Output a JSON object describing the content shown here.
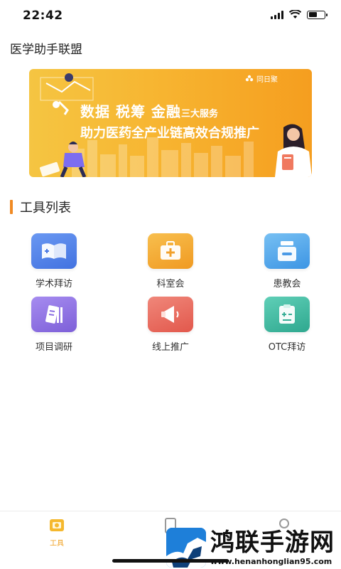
{
  "status_bar": {
    "time": "22:42",
    "icons": [
      "signal-icon",
      "wifi-icon",
      "battery-icon"
    ]
  },
  "header": {
    "title": "医学助手联盟"
  },
  "banner": {
    "brand": "同日聚",
    "line1_main": "数据 税筹 金融",
    "line1_suffix": "三大服务",
    "line2": "助力医药全产业链高效合规推广",
    "colors": {
      "start": "#f5c542",
      "end": "#f59e1f"
    }
  },
  "tools_section": {
    "title": "工具列表",
    "accent": "#f08a24",
    "items": [
      {
        "label": "学术拜访",
        "icon": "open-book-icon",
        "color": "#4f7fe8"
      },
      {
        "label": "科室会",
        "icon": "medical-kit-icon",
        "color": "#f4a52a"
      },
      {
        "label": "患教会",
        "icon": "medicine-box-icon",
        "color": "#4fa6ea"
      },
      {
        "label": "项目调研",
        "icon": "documents-icon",
        "color": "#8d6fe0"
      },
      {
        "label": "线上推广",
        "icon": "megaphone-icon",
        "color": "#ea6a5c"
      },
      {
        "label": "OTC拜访",
        "icon": "clipboard-plus-icon",
        "color": "#3fb8a2"
      }
    ]
  },
  "tab_bar": {
    "tabs": [
      {
        "label": "工具",
        "icon": "toolbox-icon",
        "active": true
      },
      {
        "label": "",
        "icon": "document-icon",
        "active": false
      },
      {
        "label": "",
        "icon": "person-icon",
        "active": false
      }
    ],
    "active_color": "#f0a020"
  },
  "watermark": {
    "title": "鸿联手游网",
    "url": "www.henanhonglian95.com"
  }
}
